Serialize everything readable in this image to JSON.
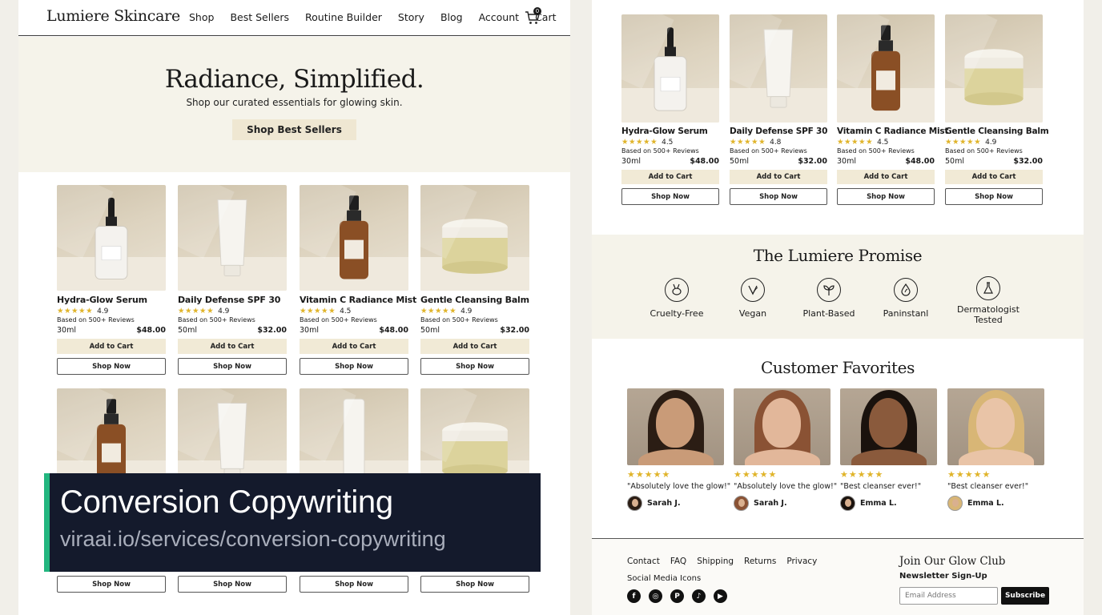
{
  "header": {
    "logo": "Lumiere Skincare",
    "nav": [
      "Shop",
      "Best Sellers",
      "Routine Builder",
      "Story",
      "Blog",
      "Account",
      "Cart"
    ],
    "cart_count": "0"
  },
  "hero": {
    "title": "Radiance, Simplified.",
    "subtitle": "Shop our curated essentials for glowing skin.",
    "button": "Shop Best Sellers"
  },
  "products": [
    {
      "name": "Hydra-Glow Serum",
      "rating": "4.9",
      "reviews": "Based on 500+ Reviews",
      "size": "30ml",
      "price": "$48.00",
      "kind": "dropper"
    },
    {
      "name": "Daily Defense SPF 30",
      "rating": "4.9",
      "reviews": "Based on 500+ Reviews",
      "size": "50ml",
      "price": "$32.00",
      "kind": "tube"
    },
    {
      "name": "Vitamin C Radiance Mist",
      "rating": "4.5",
      "reviews": "Based on 500+ Reviews",
      "size": "30ml",
      "price": "$48.00",
      "kind": "mist"
    },
    {
      "name": "Gentle Cleansing Balm",
      "rating": "4.9",
      "reviews": "Based on 500+ Reviews",
      "size": "50ml",
      "price": "$32.00",
      "kind": "jar"
    }
  ],
  "products_right": [
    {
      "name": "Hydra-Glow Serum",
      "rating": "4.5",
      "reviews": "Based on 500+ Reviews",
      "size": "30ml",
      "price": "$48.00",
      "kind": "dropper"
    },
    {
      "name": "Daily Defense SPF 30",
      "rating": "4.8",
      "reviews": "Based on 500+ Reviews",
      "size": "50ml",
      "price": "$32.00",
      "kind": "tube"
    },
    {
      "name": "Vitamin C Radiance Mist",
      "rating": "4.5",
      "reviews": "Based on 500+ Reviews",
      "size": "30ml",
      "price": "$48.00",
      "kind": "mist"
    },
    {
      "name": "Gentle Cleansing Balm",
      "rating": "4.9",
      "reviews": "Based on 500+ Reviews",
      "size": "50ml",
      "price": "$32.00",
      "kind": "jar"
    }
  ],
  "buttons": {
    "add_to_cart": "Add to Cart",
    "shop_now": "Shop Now"
  },
  "second_row_kinds": [
    "mist",
    "tube",
    "stick",
    "jar"
  ],
  "overlay": {
    "title": "Conversion Copywriting",
    "url": "viraai.io/services/conversion-copywriting",
    "accent": "#22b67f"
  },
  "promise": {
    "title": "The Lumiere Promise",
    "items": [
      {
        "label": "Cruelty-Free",
        "icon": "rabbit-icon"
      },
      {
        "label": "Vegan",
        "icon": "leaf-v-icon"
      },
      {
        "label": "Plant-Based",
        "icon": "sprout-icon"
      },
      {
        "label": "Paninstanl",
        "icon": "drop-icon"
      },
      {
        "label": "Dermatologist Tested",
        "icon": "flask-icon"
      }
    ]
  },
  "favorites": {
    "title": "Customer Favorites",
    "reviews": [
      {
        "quote": "\"Absolutely love the glow!\"",
        "author": "Sarah J.",
        "hair": "#2b1d14",
        "skin": "#c99b78"
      },
      {
        "quote": "\"Absolutely love the glow!\"",
        "author": "Sarah J.",
        "hair": "#8a5234",
        "skin": "#e2b79a"
      },
      {
        "quote": "\"Best cleanser ever!\"",
        "author": "Emma L.",
        "hair": "#1a120d",
        "skin": "#8a5a3c"
      },
      {
        "quote": "\"Best cleanser ever!\"",
        "author": "Emma L.",
        "hair": "#d8b676",
        "skin": "#e9c4a7"
      }
    ]
  },
  "footer": {
    "links": [
      "Contact",
      "FAQ",
      "Shipping",
      "Returns",
      "Privacy"
    ],
    "social_label": "Social Media Icons",
    "social": [
      {
        "name": "facebook-icon",
        "glyph": "f"
      },
      {
        "name": "instagram-icon",
        "glyph": "◎"
      },
      {
        "name": "pinterest-icon",
        "glyph": "P"
      },
      {
        "name": "tiktok-icon",
        "glyph": "♪"
      },
      {
        "name": "youtube-icon",
        "glyph": "▶"
      }
    ],
    "club_title": "Join Our Glow Club",
    "club_sub": "Newsletter Sign-Up",
    "email_placeholder": "Email Address",
    "subscribe": "Subscribe"
  },
  "colors": {
    "star": "#e0b42a",
    "hero_bg": "#f5f3ea",
    "button_bg": "#f1ead6"
  }
}
